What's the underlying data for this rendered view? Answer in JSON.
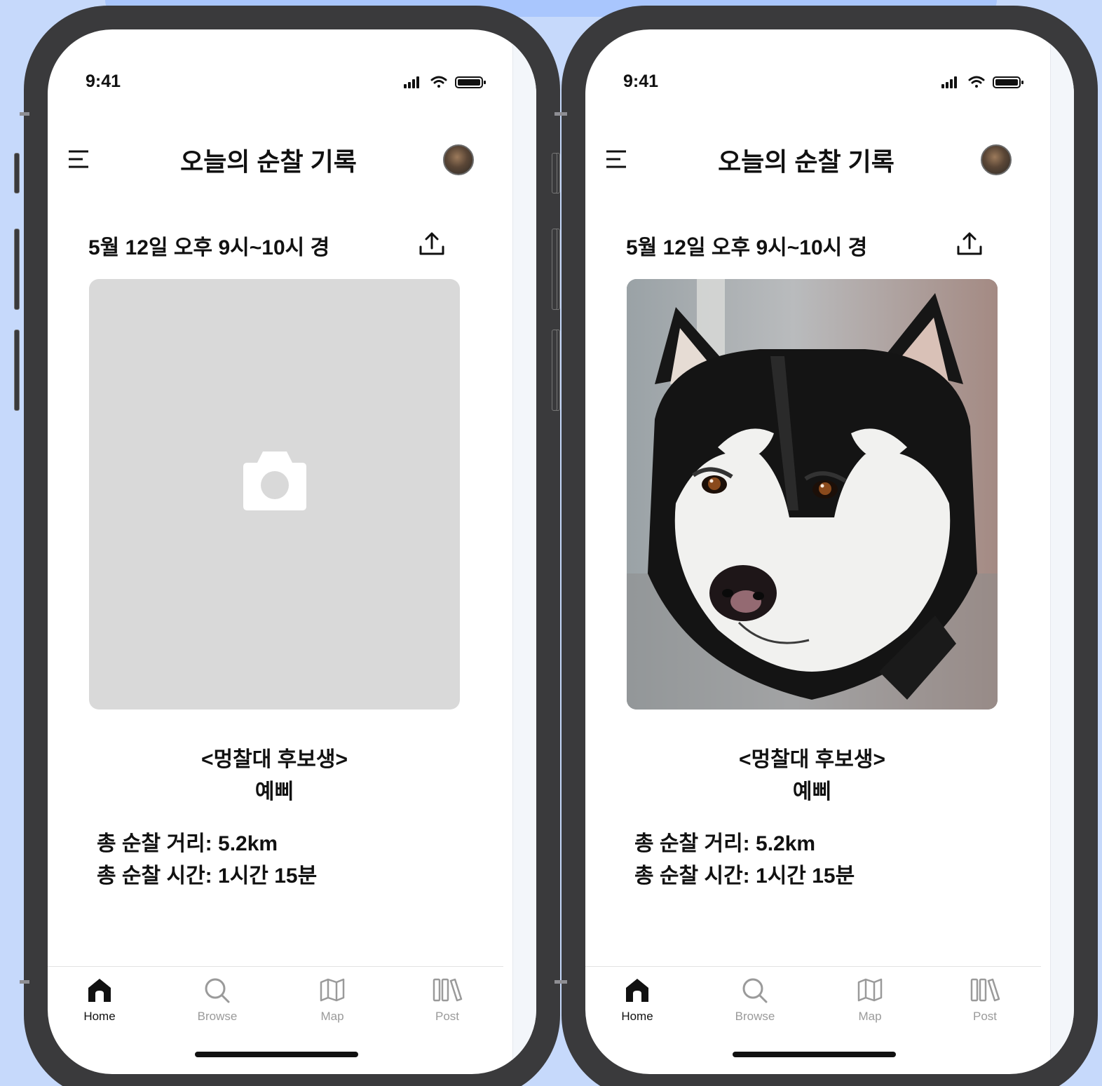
{
  "screens": [
    {
      "id": "empty",
      "status_time": "9:41",
      "title": "오늘의 순찰 기록",
      "date": "5월 12일 오후 9시~10시 경",
      "photo_state": "placeholder",
      "caption_line1": "<멍찰대 후보생>",
      "caption_line2": "예삐",
      "distance_label": "총 순찰 거리:",
      "distance_value": "5.2km",
      "time_label": "총 순찰 시간:",
      "time_value": "1시간 15분",
      "tabs": [
        {
          "label": "Home",
          "icon": "home-icon",
          "active": true
        },
        {
          "label": "Browse",
          "icon": "search-icon",
          "active": false
        },
        {
          "label": "Map",
          "icon": "map-icon",
          "active": false
        },
        {
          "label": "Post",
          "icon": "library-icon",
          "active": false
        }
      ]
    },
    {
      "id": "photo",
      "status_time": "9:41",
      "title": "오늘의 순찰 기록",
      "date": "5월 12일 오후 9시~10시 경",
      "photo_state": "husky-photo",
      "caption_line1": "<멍찰대 후보생>",
      "caption_line2": "예삐",
      "distance_label": "총 순찰 거리:",
      "distance_value": "5.2km",
      "time_label": "총 순찰 시간:",
      "time_value": "1시간 15분",
      "tabs": [
        {
          "label": "Home",
          "icon": "home-icon",
          "active": true
        },
        {
          "label": "Browse",
          "icon": "search-icon",
          "active": false
        },
        {
          "label": "Map",
          "icon": "map-icon",
          "active": false
        },
        {
          "label": "Post",
          "icon": "library-icon",
          "active": false
        }
      ]
    }
  ],
  "colors": {
    "background": "#c6d9fb",
    "frame": "#3a3a3c",
    "placeholder": "#d9d9d9",
    "text": "#111111",
    "inactive_tab": "#9a9a9a"
  }
}
